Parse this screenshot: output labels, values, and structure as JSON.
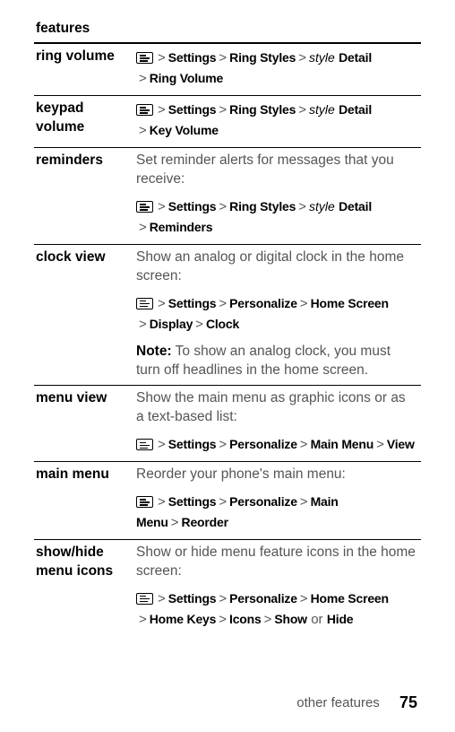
{
  "header": "features",
  "sep": ">",
  "or": "or",
  "noteLabel": "Note:",
  "rows": [
    {
      "feature": "ring volume",
      "blocks": [
        {
          "type": "path",
          "parts": [
            {
              "t": "icon"
            },
            {
              "t": "sep"
            },
            {
              "t": "lbl",
              "v": "Settings"
            },
            {
              "t": "sep"
            },
            {
              "t": "lbl",
              "v": "Ring Styles"
            },
            {
              "t": "sep"
            },
            {
              "t": "style",
              "v": "style"
            },
            {
              "t": "space"
            },
            {
              "t": "lbl",
              "v": "Detail"
            },
            {
              "t": "br"
            },
            {
              "t": "sep"
            },
            {
              "t": "lbl",
              "v": "Ring Volume"
            }
          ]
        }
      ]
    },
    {
      "feature": "keypad volume",
      "blocks": [
        {
          "type": "path",
          "parts": [
            {
              "t": "icon"
            },
            {
              "t": "sep"
            },
            {
              "t": "lbl",
              "v": "Settings"
            },
            {
              "t": "sep"
            },
            {
              "t": "lbl",
              "v": "Ring Styles"
            },
            {
              "t": "sep"
            },
            {
              "t": "style",
              "v": "style"
            },
            {
              "t": "space"
            },
            {
              "t": "lbl",
              "v": "Detail"
            },
            {
              "t": "br"
            },
            {
              "t": "sep"
            },
            {
              "t": "lbl",
              "v": "Key Volume"
            }
          ]
        }
      ]
    },
    {
      "feature": "reminders",
      "blocks": [
        {
          "type": "desc",
          "text": "Set reminder alerts for messages that you receive:"
        },
        {
          "type": "path",
          "parts": [
            {
              "t": "icon"
            },
            {
              "t": "sep"
            },
            {
              "t": "lbl",
              "v": "Settings"
            },
            {
              "t": "sep"
            },
            {
              "t": "lbl",
              "v": "Ring Styles"
            },
            {
              "t": "sep"
            },
            {
              "t": "style",
              "v": "style"
            },
            {
              "t": "space"
            },
            {
              "t": "lbl",
              "v": "Detail"
            },
            {
              "t": "br"
            },
            {
              "t": "sep"
            },
            {
              "t": "lbl",
              "v": "Reminders"
            }
          ]
        }
      ]
    },
    {
      "feature": "clock view",
      "blocks": [
        {
          "type": "desc",
          "text": "Show an analog or digital clock in the home screen:"
        },
        {
          "type": "path",
          "parts": [
            {
              "t": "icon"
            },
            {
              "t": "sep"
            },
            {
              "t": "lbl",
              "v": "Settings"
            },
            {
              "t": "sep"
            },
            {
              "t": "lbl",
              "v": "Personalize"
            },
            {
              "t": "sep"
            },
            {
              "t": "lbl",
              "v": "Home Screen"
            },
            {
              "t": "br"
            },
            {
              "t": "sep"
            },
            {
              "t": "lbl",
              "v": "Display"
            },
            {
              "t": "sep"
            },
            {
              "t": "lbl",
              "v": "Clock"
            }
          ]
        },
        {
          "type": "note",
          "text": "To show an analog clock, you must turn off headlines in the home screen."
        }
      ]
    },
    {
      "feature": "menu view",
      "blocks": [
        {
          "type": "desc",
          "text": "Show the main menu as graphic icons or as a text-based list:"
        },
        {
          "type": "path",
          "parts": [
            {
              "t": "icon"
            },
            {
              "t": "sep"
            },
            {
              "t": "lbl",
              "v": "Settings"
            },
            {
              "t": "sep"
            },
            {
              "t": "lbl",
              "v": "Personalize"
            },
            {
              "t": "sep"
            },
            {
              "t": "lbl",
              "v": "Main Menu"
            },
            {
              "t": "sep"
            },
            {
              "t": "lbl",
              "v": "View"
            }
          ]
        }
      ]
    },
    {
      "feature": "main menu",
      "blocks": [
        {
          "type": "desc",
          "text": "Reorder your phone's main menu:"
        },
        {
          "type": "path",
          "parts": [
            {
              "t": "icon"
            },
            {
              "t": "sep"
            },
            {
              "t": "lbl",
              "v": "Settings"
            },
            {
              "t": "sep"
            },
            {
              "t": "lbl",
              "v": "Personalize"
            },
            {
              "t": "sep"
            },
            {
              "t": "lbl",
              "v": "Main Menu"
            },
            {
              "t": "sep"
            },
            {
              "t": "lbl",
              "v": "Reorder"
            }
          ]
        }
      ]
    },
    {
      "feature": "show/hide menu icons",
      "blocks": [
        {
          "type": "desc",
          "text": "Show or hide menu feature icons in the home screen:"
        },
        {
          "type": "path",
          "parts": [
            {
              "t": "icon"
            },
            {
              "t": "sep"
            },
            {
              "t": "lbl",
              "v": "Settings"
            },
            {
              "t": "sep"
            },
            {
              "t": "lbl",
              "v": "Personalize"
            },
            {
              "t": "sep"
            },
            {
              "t": "lbl",
              "v": "Home Screen"
            },
            {
              "t": "br"
            },
            {
              "t": "sep"
            },
            {
              "t": "lbl",
              "v": "Home Keys"
            },
            {
              "t": "sep"
            },
            {
              "t": "lbl",
              "v": "Icons"
            },
            {
              "t": "sep"
            },
            {
              "t": "lbl",
              "v": "Show"
            },
            {
              "t": "or"
            },
            {
              "t": "lbl",
              "v": "Hide"
            }
          ]
        }
      ]
    }
  ],
  "footer": {
    "label": "other features",
    "page": "75"
  }
}
